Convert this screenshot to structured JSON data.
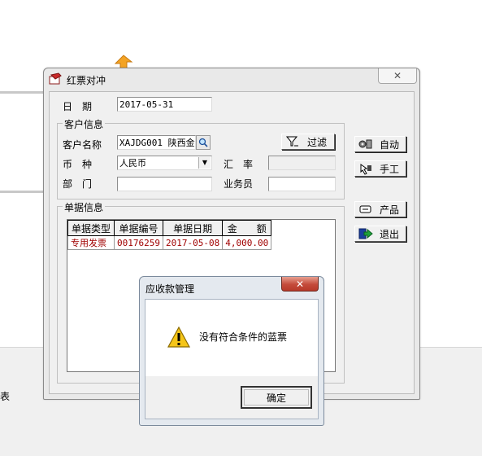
{
  "window": {
    "title": "红票对冲",
    "close_glyph": "✕"
  },
  "form": {
    "date_label": "日　期",
    "date_value": "2017-05-31",
    "customer_group_label": "客户信息",
    "customer_name_label": "客户名称",
    "customer_name_value": "XAJDG001  陕西金",
    "filter_button": "过滤",
    "currency_label": "币　种",
    "currency_value": "人民币",
    "rate_label": "汇　率",
    "rate_value": "",
    "dept_label": "部　门",
    "dept_value": "",
    "salesman_label": "业务员",
    "salesman_value": ""
  },
  "doc_group_label": "单据信息",
  "table": {
    "columns": [
      "单据类型",
      "单据编号",
      "单据日期",
      "金　　额"
    ],
    "rows": [
      [
        "专用发票",
        "00176259",
        "2017-05-08",
        "4,000.00"
      ]
    ]
  },
  "side_buttons": {
    "auto": "自动",
    "manual": "手工",
    "product": "产品",
    "exit": "退出"
  },
  "dialog": {
    "title": "应收款管理",
    "message": "没有符合条件的蓝票",
    "ok": "确定",
    "close_glyph": "✕"
  },
  "background": {
    "cut_text": "表"
  },
  "icons": {
    "window": "red-ticket-icon",
    "search": "search-icon",
    "filter": "funnel-icon",
    "warning": "warning-icon"
  },
  "colors": {
    "row_text": "#a00000",
    "dialog_close": "#c44a3a"
  }
}
